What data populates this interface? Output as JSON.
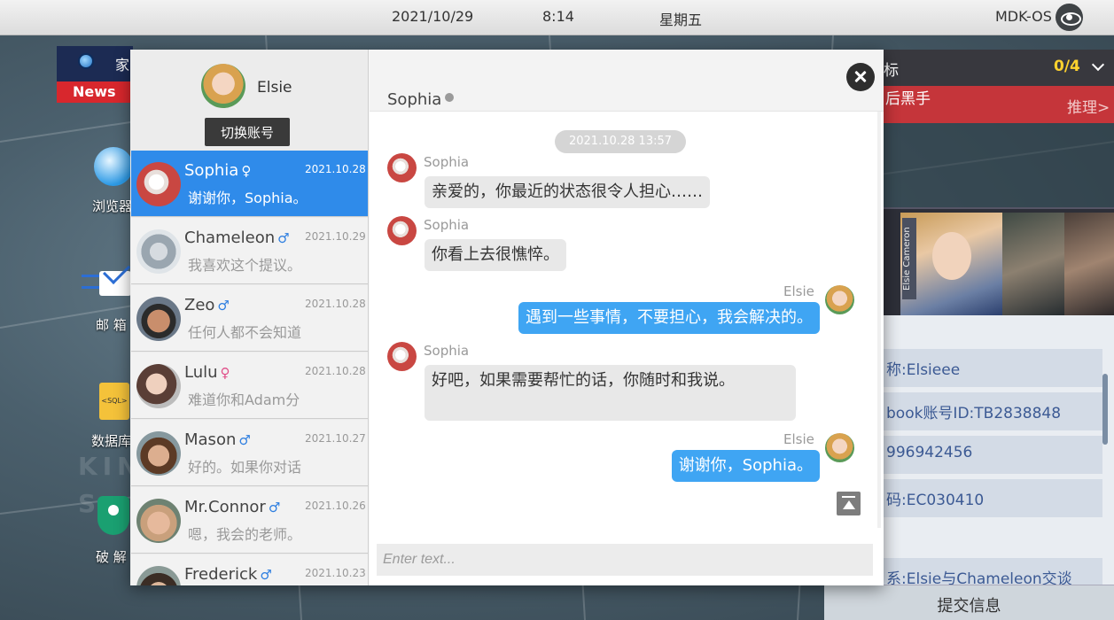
{
  "statusbar": {
    "date": "2021/10/29",
    "time": "8:14",
    "weekday": "星期五",
    "os_name": "MDK-OS",
    "os_icon": "eye-icon"
  },
  "desktop": {
    "news_home": "家",
    "news_badge": "News",
    "icons": [
      {
        "label": "浏览器",
        "icon": "browser-icon"
      },
      {
        "label": "邮 箱",
        "icon": "mail-icon"
      },
      {
        "label": "数据库",
        "icon": "sql-icon"
      },
      {
        "label": "破 解",
        "icon": "shield-icon"
      }
    ],
    "sql_text": "<SQL>"
  },
  "right_panel": {
    "task_title": "标",
    "task_count": "0/4",
    "task_name": "后黑手",
    "task_link": "推理>",
    "portrait_name_tag": "Elsie Cameron",
    "info_rows": [
      "称:Elsieee",
      "book账号ID:TB2838848",
      "996942456",
      "码:EC030410",
      "系:Elsie与Chameleon交谈"
    ],
    "submit_label": "提交信息"
  },
  "account": {
    "name": "Elsie",
    "switch_label": "切换账号"
  },
  "contacts": [
    {
      "name": "Sophia",
      "gender": "♀",
      "date": "2021.10.28",
      "preview": "谢谢你，Sophia。",
      "active": true
    },
    {
      "name": "Chameleon",
      "gender": "♂",
      "date": "2021.10.29",
      "preview": "我喜欢这个提议。"
    },
    {
      "name": "Zeo",
      "gender": "♂",
      "date": "2021.10.28",
      "preview": "任何人都不会知道"
    },
    {
      "name": "Lulu",
      "gender": "♀",
      "date": "2021.10.28",
      "preview": "难道你和Adam分"
    },
    {
      "name": "Mason",
      "gender": "♂",
      "date": "2021.10.27",
      "preview": "好的。如果你对话"
    },
    {
      "name": "Mr.Connor",
      "gender": "♂",
      "date": "2021.10.26",
      "preview": "嗯，我会的老师。"
    },
    {
      "name": "Frederick",
      "gender": "♂",
      "date": "2021.10.23",
      "preview": ""
    }
  ],
  "conversation": {
    "title": "Sophia",
    "timestamp": "2021.10.28  13:57",
    "messages": [
      {
        "from": "Sophia",
        "text": "亲爱的，你最近的状态很令人担心……"
      },
      {
        "from": "Sophia",
        "text": "你看上去很憔悴。"
      },
      {
        "from": "Elsie",
        "text": "遇到一些事情，不要担心，我会解决的。"
      },
      {
        "from": "Sophia",
        "text": "好吧，如果需要帮忙的话，你随时和我说。"
      },
      {
        "from": "Elsie",
        "text": "谢谢你，Sophia。"
      }
    ],
    "input_placeholder": "Enter text..."
  },
  "colors": {
    "active_contact": "#2f8bea",
    "outgoing_bubble": "#3fa5f3",
    "incoming_bubble": "#e8e8e8",
    "news_red": "#d8272d",
    "task_count": "#ffd22e"
  }
}
